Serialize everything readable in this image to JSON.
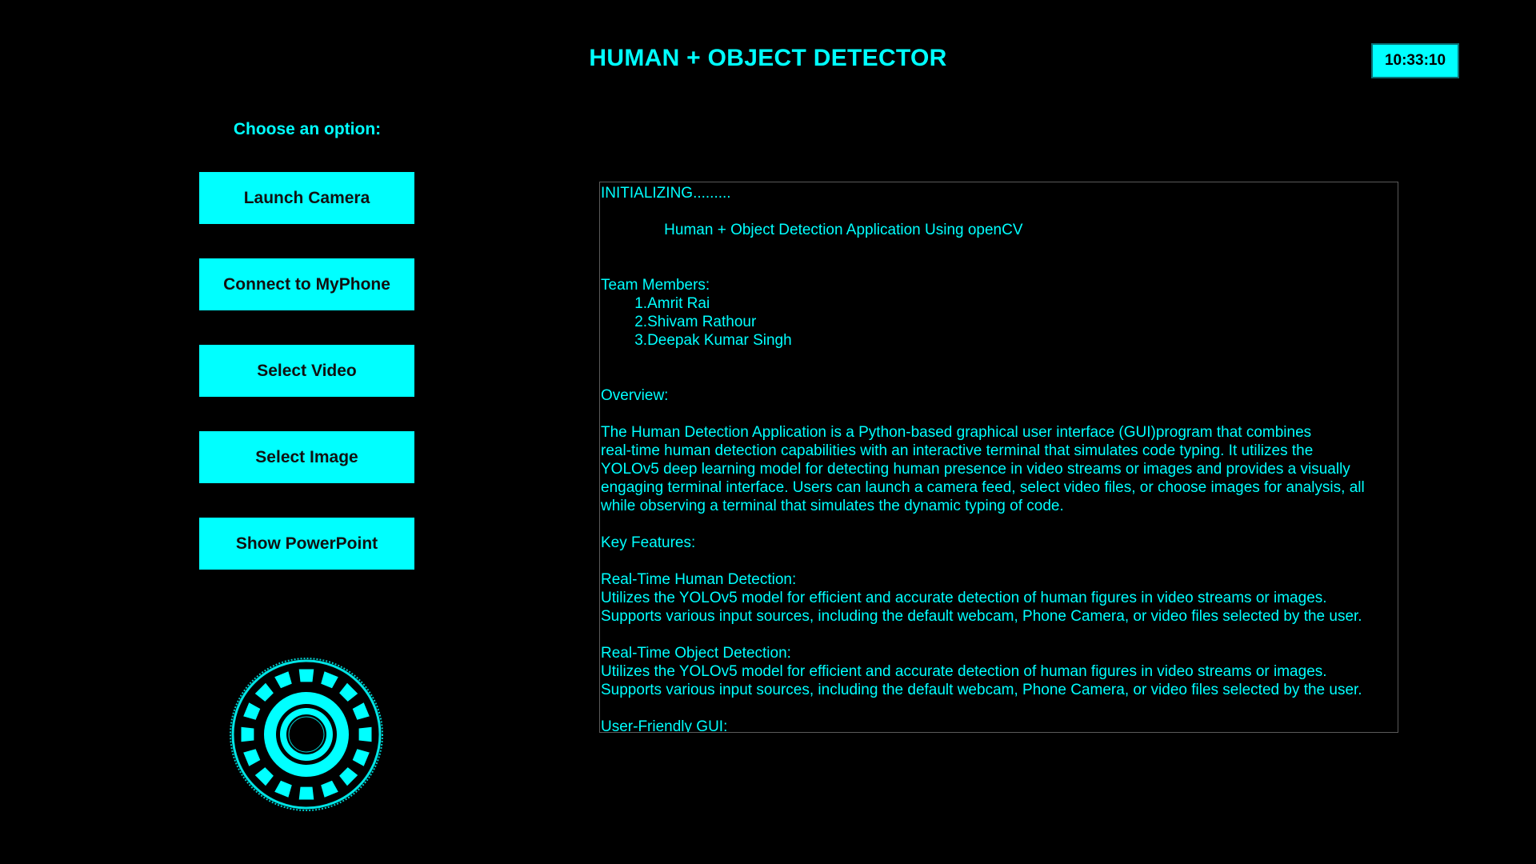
{
  "app": {
    "title": "HUMAN + OBJECT DETECTOR",
    "clock": "10:33:10"
  },
  "sidebar": {
    "prompt": "Choose an option:",
    "buttons": [
      {
        "label": "Launch Camera"
      },
      {
        "label": "Connect to MyPhone"
      },
      {
        "label": "Select Video"
      },
      {
        "label": "Select Image"
      },
      {
        "label": "Show PowerPoint"
      }
    ],
    "logo_icon": "arc-reactor-icon"
  },
  "terminal": {
    "text": "INITIALIZING.........\n\n               Human + Object Detection Application Using openCV\n\n\nTeam Members:\n        1.Amrit Rai\n        2.Shivam Rathour\n        3.Deepak Kumar Singh\n\n\nOverview:\n\nThe Human Detection Application is a Python-based graphical user interface (GUI)program that combines\nreal-time human detection capabilities with an interactive terminal that simulates code typing. It utilizes the\nYOLOv5 deep learning model for detecting human presence in video streams or images and provides a visually\nengaging terminal interface. Users can launch a camera feed, select video files, or choose images for analysis, all\nwhile observing a terminal that simulates the dynamic typing of code.\n\nKey Features:\n\nReal-Time Human Detection:\nUtilizes the YOLOv5 model for efficient and accurate detection of human figures in video streams or images.\nSupports various input sources, including the default webcam, Phone Camera, or video files selected by the user.\n\nReal-Time Object Detection:\nUtilizes the YOLOv5 model for efficient and accurate detection of human figures in video streams or images.\nSupports various input sources, including the default webcam, Phone Camera, or video files selected by the user.\n\nUser-Friendly GUI:"
  },
  "colors": {
    "background": "#000000",
    "accent": "#00ffff",
    "button_text": "#111111",
    "terminal_border": "#5a5a5a"
  }
}
